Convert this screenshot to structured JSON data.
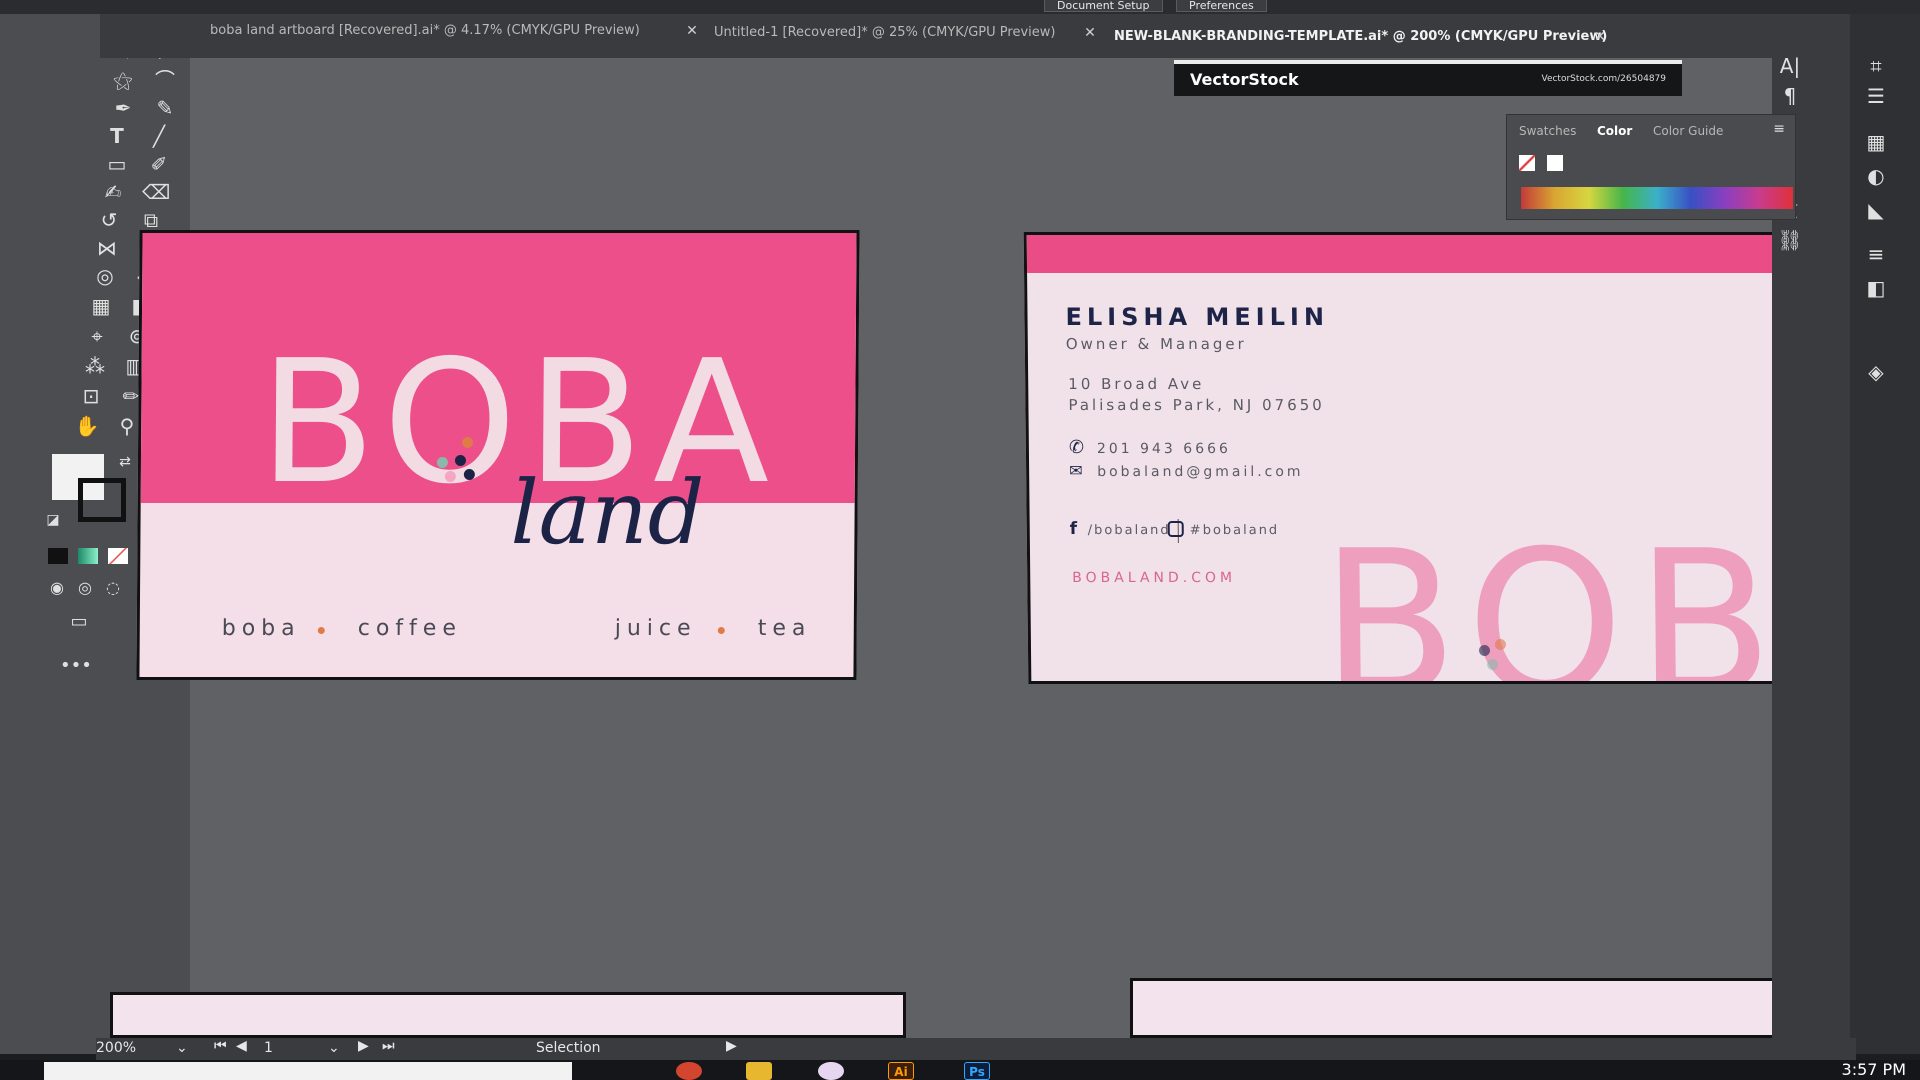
{
  "topbar": {
    "document_setup": "Document Setup",
    "preferences": "Preferences"
  },
  "tabs": [
    {
      "label": "boba land artboard [Recovered].ai* @ 4.17% (CMYK/GPU Preview)"
    },
    {
      "label": "Untitled-1 [Recovered]* @ 25% (CMYK/GPU Preview)"
    },
    {
      "label": "NEW-BLANK-BRANDING-TEMPLATE.ai* @ 200% (CMYK/GPU Preview)"
    }
  ],
  "vectorstock": {
    "logo": "VectorStock",
    "url": "VectorStock.com/26504879"
  },
  "color_panel": {
    "tabs": [
      "Swatches",
      "Color",
      "Color Guide"
    ],
    "active_tab": "Color"
  },
  "card_front": {
    "brand_top": "BOBA",
    "brand_script": "land",
    "taglines": [
      "boba",
      "coffee",
      "juice",
      "tea"
    ],
    "colors": {
      "pink": "#ec4f89",
      "navy": "#1d2347",
      "cream": "#f4dfe8",
      "dot": "#e07a47"
    }
  },
  "card_back": {
    "name": "ELISHA MEILIN",
    "role": "Owner & Manager",
    "address_line1": "10 Broad Ave",
    "address_line2": "Palisades Park, NJ 07650",
    "phone": "201 943 6666",
    "email": "bobaland@gmail.com",
    "facebook": "/bobaland",
    "instagram": "#bobaland",
    "website": "BOBALAND.COM",
    "watermark": "BOBA"
  },
  "statusbar": {
    "zoom": "200%",
    "artboard": "1",
    "tool": "Selection"
  },
  "taskbar": {
    "clock": "3:57 PM"
  }
}
